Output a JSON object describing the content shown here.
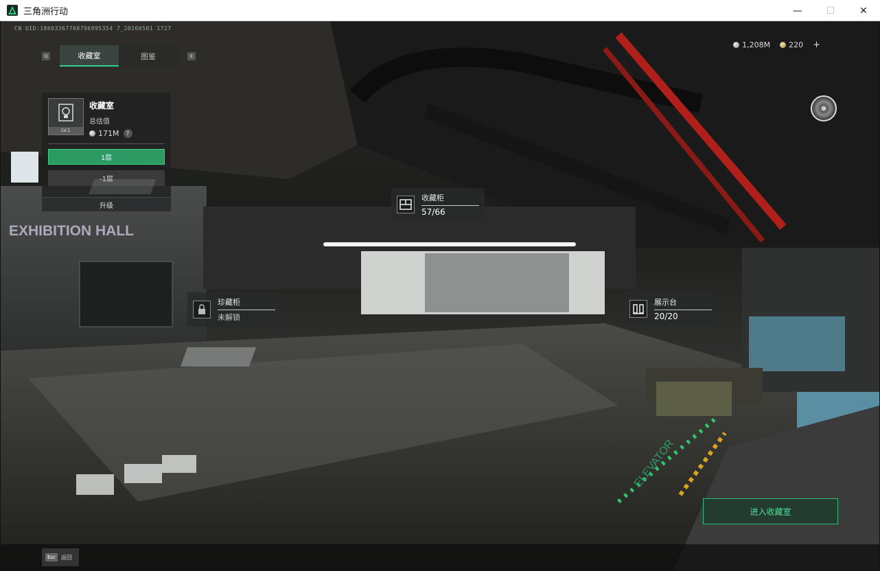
{
  "window": {
    "title": "三角洲行动",
    "controls": {
      "minimize": "—",
      "maximize": "☐",
      "close": "✕"
    }
  },
  "hud": {
    "uid": "CN UID:18603367768796995354 7_20260501 1727",
    "tabs": {
      "left_key": "Q",
      "right_key": "E",
      "active": "收藏室",
      "inactive": "图鉴"
    },
    "currency": {
      "silver": "1,208M",
      "gold": "220",
      "add": "+"
    },
    "disc_icon": "disc-icon"
  },
  "panel": {
    "title": "收藏室",
    "subtitle": "总估值",
    "value": "171M",
    "help": "?",
    "level": "LV.1",
    "floors": [
      "1层",
      "-1层"
    ],
    "upgrade": "升级"
  },
  "hotspots": {
    "cabinet": {
      "label": "收藏柜",
      "value": "57/66"
    },
    "rare": {
      "label": "珍藏柜",
      "value": "未解锁"
    },
    "display": {
      "label": "展示台",
      "value": "20/20"
    }
  },
  "scene_text": {
    "hall": "EXHIBITION HALL",
    "elevator": "ELEVATOR"
  },
  "enter_button": "进入收藏室",
  "footer": {
    "esc_key": "Esc",
    "esc_label": "返回"
  },
  "colors": {
    "accent": "#2fd08a",
    "pipe_red": "#b0201a"
  }
}
